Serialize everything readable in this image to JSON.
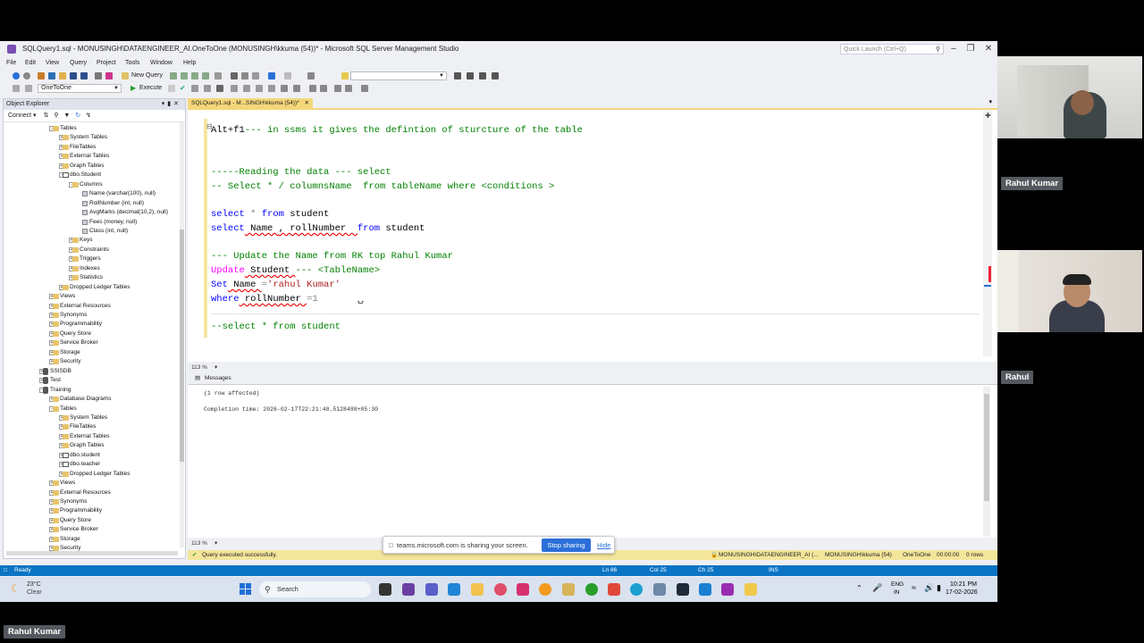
{
  "window": {
    "title": "SQLQuery1.sql - MONUSINGH\\DATAENGINEER_AI.OneToOne (MONUSINGH\\kkuma (54))* - Microsoft SQL Server Management Studio",
    "quick_launch_placeholder": "Quick Launch (Ctrl+Q)",
    "quick_launch_icon": "search-icon"
  },
  "menu": [
    "File",
    "Edit",
    "View",
    "Query",
    "Project",
    "Tools",
    "Window",
    "Help"
  ],
  "toolbar": {
    "new_query": "New Query",
    "execute": "Execute",
    "database_select": "OneToOne"
  },
  "object_explorer": {
    "title": "Object Explorer",
    "connect": "Connect",
    "nodes": [
      {
        "label": "Tables",
        "icon": "folder"
      },
      {
        "label": "System Tables",
        "icon": "folder"
      },
      {
        "label": "FileTables",
        "icon": "folder"
      },
      {
        "label": "External Tables",
        "icon": "folder"
      },
      {
        "label": "Graph Tables",
        "icon": "folder"
      },
      {
        "label": "dbo.Student",
        "icon": "table"
      },
      {
        "label": "Columns",
        "icon": "folder"
      },
      {
        "label": "Name (varchar(100), null)",
        "icon": "column"
      },
      {
        "label": "RollNumber (int, null)",
        "icon": "column"
      },
      {
        "label": "AvgMarks (decimal(10,2), null)",
        "icon": "column"
      },
      {
        "label": "Fees (money, null)",
        "icon": "column"
      },
      {
        "label": "Class (int, null)",
        "icon": "column"
      },
      {
        "label": "Keys",
        "icon": "folder"
      },
      {
        "label": "Constraints",
        "icon": "folder"
      },
      {
        "label": "Triggers",
        "icon": "folder"
      },
      {
        "label": "Indexes",
        "icon": "folder"
      },
      {
        "label": "Statistics",
        "icon": "folder"
      },
      {
        "label": "Dropped Ledger Tables",
        "icon": "folder"
      },
      {
        "label": "Views",
        "icon": "folder"
      },
      {
        "label": "External Resources",
        "icon": "folder"
      },
      {
        "label": "Synonyms",
        "icon": "folder"
      },
      {
        "label": "Programmability",
        "icon": "folder"
      },
      {
        "label": "Query Store",
        "icon": "folder"
      },
      {
        "label": "Service Broker",
        "icon": "folder"
      },
      {
        "label": "Storage",
        "icon": "folder"
      },
      {
        "label": "Security",
        "icon": "folder"
      },
      {
        "label": "SSISDB",
        "icon": "database"
      },
      {
        "label": "Test",
        "icon": "database"
      },
      {
        "label": "Training",
        "icon": "database"
      },
      {
        "label": "Database Diagrams",
        "icon": "folder"
      },
      {
        "label": "Tables",
        "icon": "folder"
      },
      {
        "label": "System Tables",
        "icon": "folder"
      },
      {
        "label": "FileTables",
        "icon": "folder"
      },
      {
        "label": "External Tables",
        "icon": "folder"
      },
      {
        "label": "Graph Tables",
        "icon": "folder"
      },
      {
        "label": "dbo.student",
        "icon": "table"
      },
      {
        "label": "dbo.teacher",
        "icon": "table"
      },
      {
        "label": "Dropped Ledger Tables",
        "icon": "folder"
      },
      {
        "label": "Views",
        "icon": "folder"
      },
      {
        "label": "External Resources",
        "icon": "folder"
      },
      {
        "label": "Synonyms",
        "icon": "folder"
      },
      {
        "label": "Programmability",
        "icon": "folder"
      },
      {
        "label": "Query Store",
        "icon": "folder"
      },
      {
        "label": "Service Broker",
        "icon": "folder"
      },
      {
        "label": "Storage",
        "icon": "folder"
      },
      {
        "label": "Security",
        "icon": "folder"
      }
    ]
  },
  "editor": {
    "tab_label": "SQLQuery1.sql - M...SINGH\\kkuma (54))*",
    "zoom": "113 %",
    "lines": {
      "l1_key": "Alt+f1",
      "l1_comment": "--- in ssms it gives the defintion of sturcture of the table",
      "l2": "-----Reading the data --- select",
      "l3": "-- Select * / columnsName  from tableName where <conditions >",
      "l4_kw": "select",
      "l4_rest": " * ",
      "l4_kw2": "from",
      "l4_tbl": " student",
      "l5_kw": "select",
      "l5_a": " Name ",
      "l5_b": ", rollNumber  ",
      "l5_kw2": "from",
      "l5_tbl": " student",
      "l6": "--- Update the Name from RK top Rahul Kumar",
      "l7_kw": "Update",
      "l7_tbl": " Student ",
      "l7_comment": "--- <TableName>",
      "l8_kw": "Set",
      "l8_col": " Name ",
      "l8_eq": "=",
      "l8_str": "'rahul Kumar'",
      "l9_kw": "where",
      "l9_col": " rollNumber ",
      "l9_eq": "=1",
      "l10": "--select * from student"
    }
  },
  "messages": {
    "tab_label": "Messages",
    "rows_affected": "(1 row affected)",
    "completion": "Completion time: 2026-02-17T22:21:40.5128488+05:30",
    "zoom": "113 %"
  },
  "query_status": {
    "text": "Query executed successfully.",
    "server": "MONUSINGH\\DATAENGINEER_AI (...",
    "user": "MONUSINGH\\kkuma (54)",
    "database": "OneToOne",
    "elapsed": "00:00:00",
    "rows": "0 rows"
  },
  "app_status": {
    "ready": "Ready",
    "ln": "Ln 86",
    "col": "Col 25",
    "ch": "Ch 25",
    "ins": "INS"
  },
  "share_banner": {
    "text": "teams.microsoft.com is sharing your screen.",
    "stop": "Stop sharing",
    "hide": "Hide"
  },
  "taskbar": {
    "temp": "23°C",
    "weather": "Clear",
    "search": "Search",
    "lang1": "ENG",
    "lang2": "IN",
    "time": "10:21 PM",
    "date": "17-02-2026"
  },
  "participants": {
    "p1": "Rahul Kumar",
    "p2": "Rahul",
    "self": "Rahul Kumar"
  },
  "colors": {
    "accent_blue": "#0b74c4",
    "tab_yellow": "#f5d77a",
    "stop_button": "#2b6fd8"
  }
}
